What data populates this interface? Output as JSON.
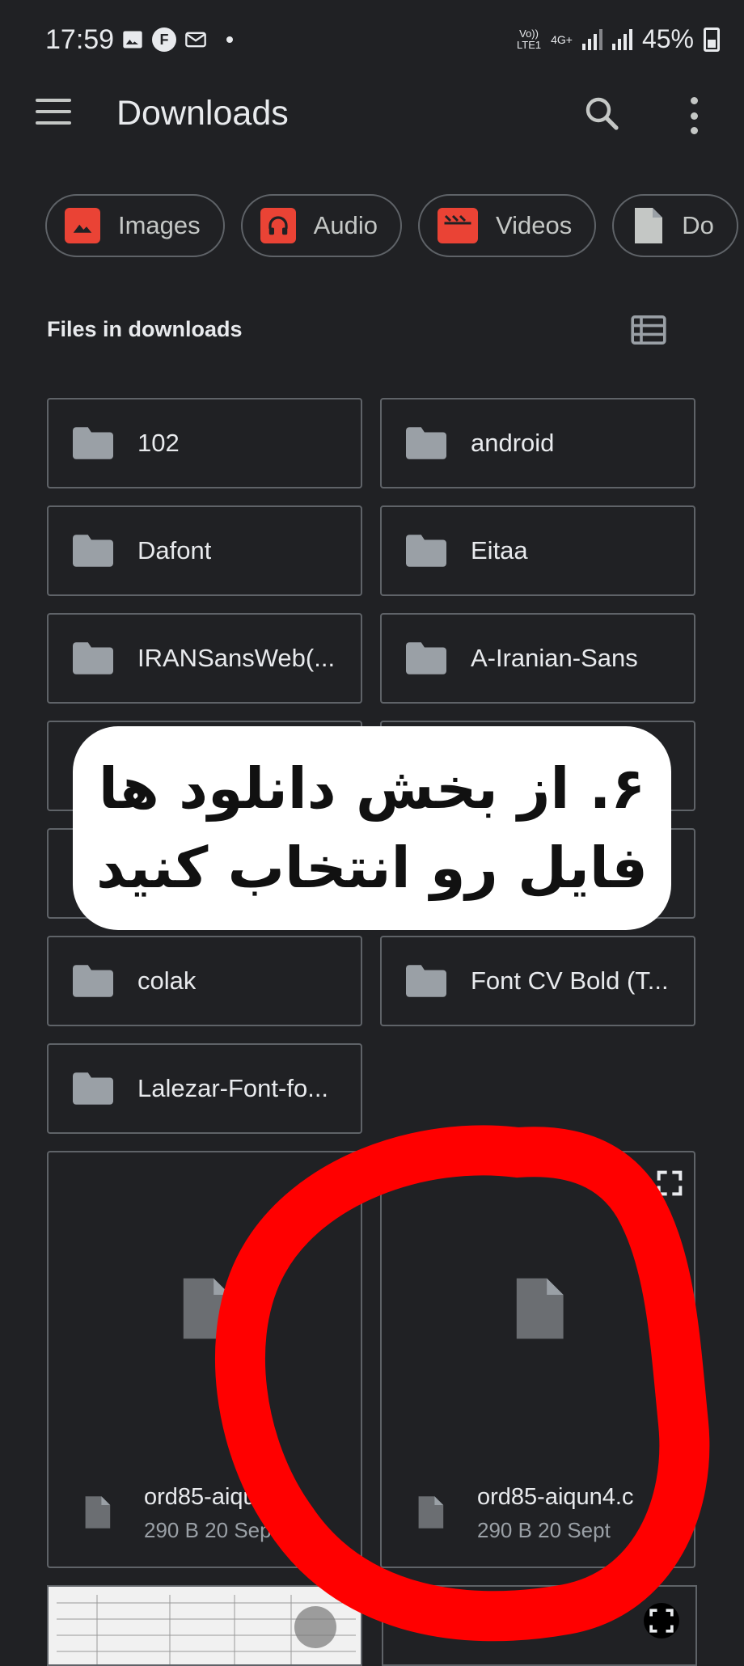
{
  "status_bar": {
    "time": "17:59",
    "notif_badge": "F",
    "net_top": "Vo))",
    "net_bottom": "LTE1",
    "net_type": "4G+",
    "battery": "45%"
  },
  "app_bar": {
    "title": "Downloads"
  },
  "chips": [
    {
      "label": "Images",
      "icon": "image-icon",
      "color": "#ea4335"
    },
    {
      "label": "Audio",
      "icon": "headphones-icon",
      "color": "#ea4335"
    },
    {
      "label": "Videos",
      "icon": "clapperboard-icon",
      "color": "#ea4335"
    },
    {
      "label": "Do",
      "icon": "document-icon",
      "color": "#c4c7c5"
    }
  ],
  "section": {
    "title": "Files in downloads"
  },
  "folders": [
    {
      "name": "102"
    },
    {
      "name": "android"
    },
    {
      "name": "Dafont"
    },
    {
      "name": "Eitaa"
    },
    {
      "name": "IRANSansWeb(..."
    },
    {
      "name": "A-Iranian-Sans"
    },
    {
      "name": "colak"
    },
    {
      "name": "Font CV Bold (T..."
    },
    {
      "name": "Lalezar-Font-fo..."
    }
  ],
  "files": [
    {
      "name": "ord85-aiqun...",
      "meta": "290 B 20 Sept"
    },
    {
      "name": "ord85-aiqun4.c",
      "meta": "290 B 20 Sept"
    }
  ],
  "overlay": {
    "line1": "۶. از بخش دانلود ها",
    "line2": "فایل رو انتخاب کنید"
  },
  "colors": {
    "background": "#202124",
    "accent_red": "#ff0000",
    "border": "#5f6368"
  }
}
